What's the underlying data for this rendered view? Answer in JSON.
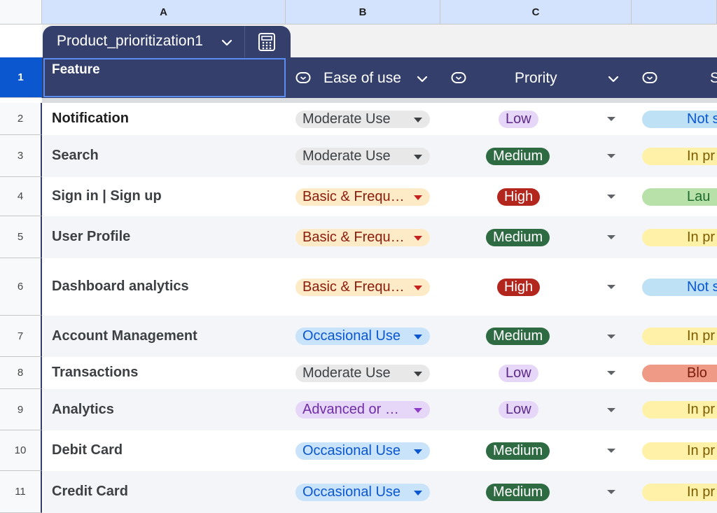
{
  "column_headers": [
    "A",
    "B",
    "C"
  ],
  "table_name": "Product_prioritization1",
  "header_row": {
    "row_number": "1",
    "feature": "Feature",
    "ease_of_use": "Ease of use",
    "priority": "Prority",
    "status_partial": "S"
  },
  "colors": {
    "header_bg": "#34406b",
    "grey_chip": "#e8e8e8",
    "orange_chip": "#fdebc8",
    "blue_chip": "#c9e3fb",
    "purple_chip": "#e6d6f7",
    "green_pill": "#2e6b43",
    "red_pill": "#b3261e"
  },
  "rows": [
    {
      "num": "2",
      "feature": "Notification",
      "ease": "Moderate Use",
      "priority": "Low",
      "status": "Not s"
    },
    {
      "num": "3",
      "feature": "Search",
      "ease": "Moderate Use",
      "priority": "Medium",
      "status": "In pr"
    },
    {
      "num": "4",
      "feature": "Sign in | Sign up",
      "ease": "Basic & Frequ…",
      "priority": "High",
      "status": "Lau"
    },
    {
      "num": "5",
      "feature": "User Profile",
      "ease": "Basic & Frequ…",
      "priority": "Medium",
      "status": "In pr"
    },
    {
      "num": "6",
      "feature": "Dashboard analytics",
      "ease": "Basic & Frequ…",
      "priority": "High",
      "status": "Not s"
    },
    {
      "num": "7",
      "feature": "Account Management",
      "ease": "Occasional Use",
      "priority": "Medium",
      "status": "In pr"
    },
    {
      "num": "8",
      "feature": "Transactions",
      "ease": "Moderate Use",
      "priority": "Low",
      "status": "Blo"
    },
    {
      "num": "9",
      "feature": "Analytics",
      "ease": "Advanced or …",
      "priority": "Low",
      "status": "In pr"
    },
    {
      "num": "10",
      "feature": "Debit Card",
      "ease": "Occasional Use",
      "priority": "Medium",
      "status": "In pr"
    },
    {
      "num": "11",
      "feature": "Credit Card",
      "ease": "Occasional Use",
      "priority": "Medium",
      "status": "In pr"
    }
  ]
}
